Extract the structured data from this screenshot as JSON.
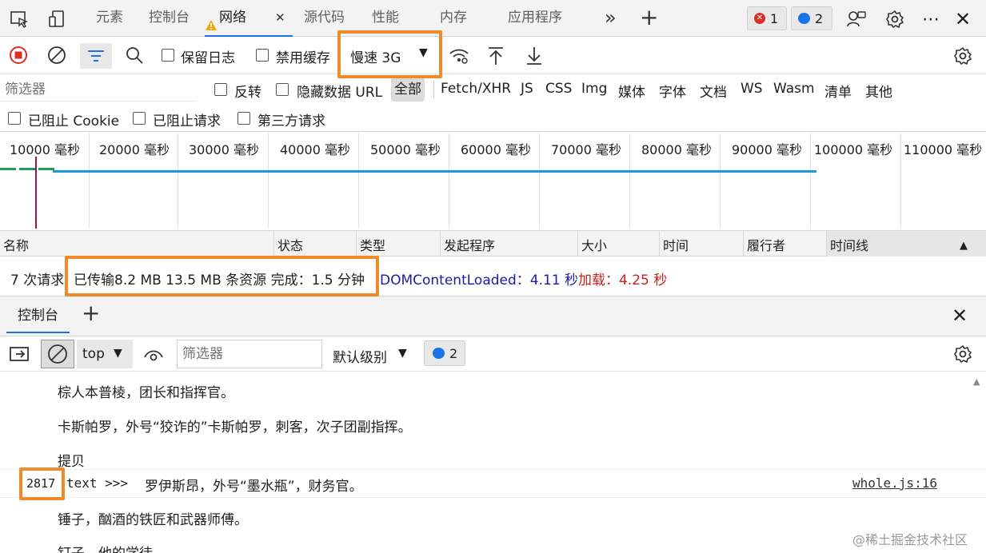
{
  "tabs": {
    "items": [
      "元素",
      "控制台",
      "网络",
      "源代码",
      "性能",
      "内存",
      "应用程序"
    ],
    "active_index": 2,
    "close_glyph": "✕",
    "more_glyph": "»",
    "add_glyph": "+"
  },
  "badges": {
    "errors": "1",
    "messages": "2"
  },
  "toolbar": {
    "preserve_log": "保留日志",
    "disable_cache": "禁用缓存",
    "throttle": "慢速 3G"
  },
  "filters": {
    "placeholder": "筛选器",
    "invert": "反转",
    "hide_data_url": "隐藏数据 URL",
    "types": [
      "全部",
      "Fetch/XHR",
      "JS",
      "CSS",
      "Img",
      "媒体",
      "字体",
      "文档",
      "WS",
      "Wasm",
      "清单",
      "其他"
    ],
    "active_type": "全部",
    "blocked_cookies": "已阻止 Cookie",
    "blocked_requests": "已阻止请求",
    "third_party": "第三方请求"
  },
  "timeline": {
    "ticks": [
      "10000  毫秒",
      "20000  毫秒",
      "30000  毫秒",
      "40000  毫秒",
      "50000  毫秒",
      "60000  毫秒",
      "70000  毫秒",
      "80000  毫秒",
      "90000  毫秒",
      "100000  毫秒",
      "110000  毫秒"
    ]
  },
  "columns": [
    "名称",
    "状态",
    "类型",
    "发起程序",
    "大小",
    "时间",
    "履行者",
    "时间线"
  ],
  "summary": {
    "requests": "7 次请求",
    "transferred": "已传输8.2 MB  13.5 MB 条资源  完成：1.5 分钟",
    "dcl": "DOMContentLoaded：4.11 秒",
    "load": "加载：4.25 秒"
  },
  "drawer": {
    "tab": "控制台",
    "add": "+",
    "close": "✕"
  },
  "console_toolbar": {
    "context": "top",
    "filter_placeholder": "筛选器",
    "level": "默认级别",
    "message_count": "2"
  },
  "console_lines": [
    "棕人本普棱，团长和指挥官。",
    "卡斯帕罗，外号“狡诈的”卡斯帕罗，刺客，次子团副指挥。",
    "提贝"
  ],
  "log_entry": {
    "count": "2817",
    "prefix": "text >>>",
    "text": "罗伊斯昂，外号“墨水瓶”，财务官。",
    "source": "whole.js:16"
  },
  "console_lines_after": [
    "锤子，酗酒的铁匠和武器师傅。",
    "钉子，他的学徒"
  ],
  "watermark": "@稀土掘金技术社区",
  "colors": {
    "accent": "#1a73e8",
    "highlight": "#f18a2a",
    "record": "#d93025",
    "dcl": "#1a1aa6",
    "load": "#c5221f"
  }
}
